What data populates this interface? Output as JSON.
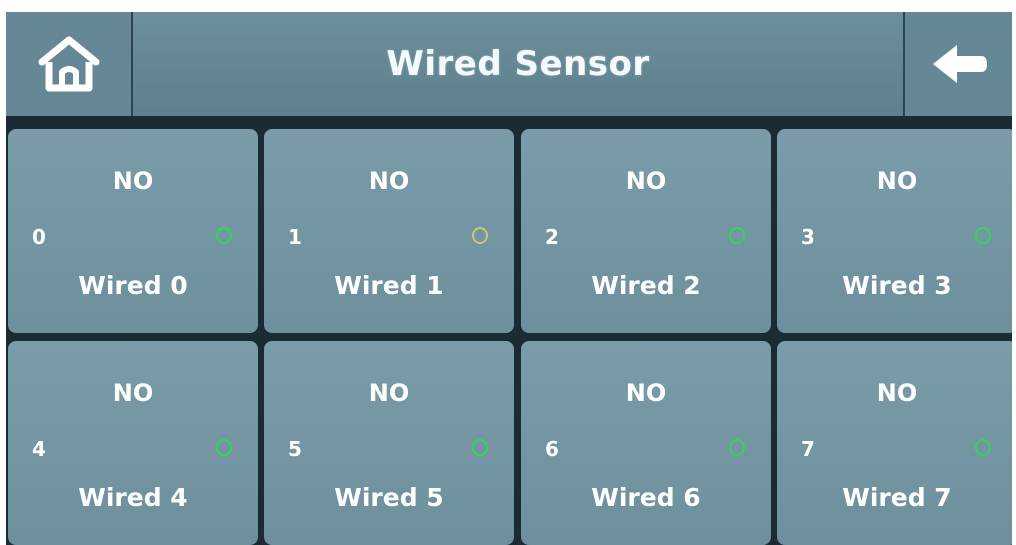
{
  "header": {
    "title": "Wired Sensor",
    "home_icon": "home-icon",
    "back_icon": "back-arrow-icon"
  },
  "sensors": [
    {
      "status": "NO",
      "index": "0",
      "name": "Wired 0",
      "led": "green"
    },
    {
      "status": "NO",
      "index": "1",
      "name": "Wired 1",
      "led": "amber"
    },
    {
      "status": "NO",
      "index": "2",
      "name": "Wired 2",
      "led": "green"
    },
    {
      "status": "NO",
      "index": "3",
      "name": "Wired 3",
      "led": "green"
    },
    {
      "status": "NO",
      "index": "4",
      "name": "Wired 4",
      "led": "green"
    },
    {
      "status": "NO",
      "index": "5",
      "name": "Wired 5",
      "led": "green"
    },
    {
      "status": "NO",
      "index": "6",
      "name": "Wired 6",
      "led": "green"
    },
    {
      "status": "NO",
      "index": "7",
      "name": "Wired 7",
      "led": "green"
    }
  ],
  "colors": {
    "led_green": "#37d25a",
    "led_amber": "#c9c772",
    "tile": "#739501"
  }
}
